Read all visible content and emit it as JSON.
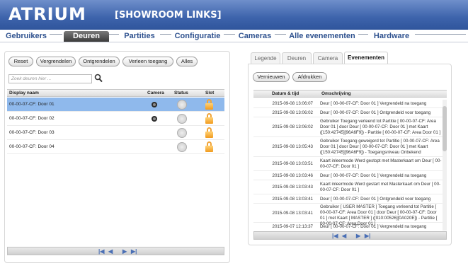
{
  "header": {
    "logo": "ATRIUM",
    "subtitle": "[SHOWROOM LINKS]"
  },
  "nav": {
    "items": [
      {
        "label": "Gebruikers"
      },
      {
        "label": "Deuren"
      },
      {
        "label": "Partities"
      },
      {
        "label": "Configuratie"
      },
      {
        "label": "Cameras"
      },
      {
        "label": "Alle evenementen"
      },
      {
        "label": "Hardware"
      }
    ],
    "active": "Deuren"
  },
  "left": {
    "buttons": [
      "Reset",
      "Vergrendelen",
      "Ontgrendelen",
      "Verleen toegang",
      "Alles"
    ],
    "search_placeholder": "Zoek deuren hier ...",
    "columns": [
      "Display naam",
      "Camera",
      "Status",
      "Slot"
    ],
    "rows": [
      {
        "name": "00-00-07-CF: Door 01",
        "camera": true,
        "selected": true
      },
      {
        "name": "00-00-07-CF: Door 02",
        "camera": true,
        "selected": false
      },
      {
        "name": "00-00-07-CF: Door 03",
        "camera": false,
        "selected": false
      },
      {
        "name": "00-00-07-CF: Door 04",
        "camera": false,
        "selected": false
      }
    ],
    "pager": [
      "|◀",
      "◀",
      "▶",
      "▶|"
    ]
  },
  "right": {
    "tabs": [
      "Legende",
      "Deuren",
      "Camera",
      "Evenementen"
    ],
    "active_tab": "Evenementen",
    "buttons": [
      "Vernieuwen",
      "Afdrukken"
    ],
    "columns": [
      "Datum & tijd",
      "Omschrijving"
    ],
    "events": [
      {
        "date": "2015-09-08 13:06:07",
        "desc": "Deur [ 00-00-07-CF: Door 01 ] Vergrendeld na toegang"
      },
      {
        "date": "2015-09-08 13:06:02",
        "desc": "Deur [ 00-00-07-CF: Door 01 ] Ontgrendeld voor toegang"
      },
      {
        "date": "2015-09-08 13:06:02",
        "desc": "Gebruiker Toegang verleend tot Partitie [ 00-00-07-CF: Area Door 01 ] door Deur [ 00-00-07-CF: Door 01 ] met Kaart ([150:42745][96A6F9]) - Partitie [ 00-00-07-CF: Area Door 01 ]"
      },
      {
        "date": "2015-09-08 13:05:43",
        "desc": "Gebruiker Toegang geweigerd tot Partitie [ 00-00-07-CF: Area Door 01 ] door Deur [ 00-00-07-CF: Door 01 ] met Kaart ([150:42745][96A6F9]) - Toegangsniveau Onbekend"
      },
      {
        "date": "2015-09-08 13:03:51",
        "desc": "Kaart inleermode Werd gestopt met Masterkaart om Deur [ 00-00-07-CF: Door 01 ]"
      },
      {
        "date": "2015-09-08 13:03:46",
        "desc": "Deur [ 00-00-07-CF: Door 01 ] Vergrendeld na toegang"
      },
      {
        "date": "2015-09-08 13:03:43",
        "desc": "Kaart inleermode Werd gestart met Masterkaart om Deur [ 00-00-07-CF: Door 01 ]"
      },
      {
        "date": "2015-09-08 13:03:41",
        "desc": "Deur [ 00-00-07-CF: Door 01 ] Ontgrendeld voor toegang"
      },
      {
        "date": "2015-09-08 13:03:41",
        "desc": "Gebruiker [ USER MASTER ] Toegang verleend tot Partitie [ 00-00-07-CF: Area Door 01 ] door Deur [ 00-00-07-CF: Door 01 ] met Kaart [ MASTER ] ([010:00526][0A020E]) - Partitie [ 00-00-07-CF: Area Door 01 ]"
      },
      {
        "date": "2015-09-07 12:13:37",
        "desc": "Deur [ 00-00-07-CF: Door 01 ] Vergrendeld na toegang"
      }
    ],
    "pager": [
      "|◀",
      "◀",
      "▶",
      "▶|"
    ]
  }
}
